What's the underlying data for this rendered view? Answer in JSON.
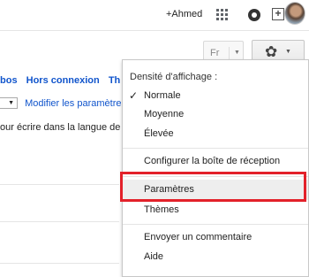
{
  "header": {
    "user_link": "+Ahmed",
    "share_glyph": "+",
    "icons": [
      "apps-grid-icon",
      "notifications-icon",
      "share-icon",
      "avatar"
    ]
  },
  "toolbar": {
    "language_button": "Fr",
    "language_caret": "▼",
    "settings_gear_glyph": "✿",
    "settings_caret": "▼"
  },
  "settings_page": {
    "tabs": [
      "bos",
      "Hors connexion",
      "Th"
    ],
    "select_caret": "▼",
    "modify_link": "Modifier les paramètres",
    "hint_text": "our écrire dans la langue de v"
  },
  "menu": {
    "heading": "Densité d'affichage :",
    "check_glyph": "✓",
    "density_items": [
      "Normale",
      "Moyenne",
      "Élevée"
    ],
    "selected_density": "Normale",
    "configure_inbox": "Configurer la boîte de réception",
    "settings": "Paramètres",
    "themes": "Thèmes",
    "send_feedback": "Envoyer un commentaire",
    "help": "Aide"
  },
  "colors": {
    "link_blue": "#1155cc",
    "highlight_red": "#e3212a",
    "menu_hover": "#eeeeee"
  }
}
